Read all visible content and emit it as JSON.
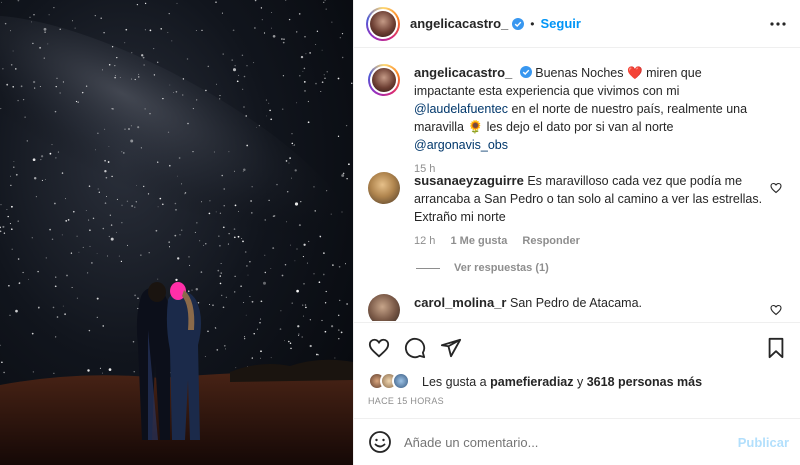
{
  "header": {
    "username": "angelicacastro_",
    "separator": "•",
    "follow_label": "Seguir",
    "more_icon": "more-horizontal-icon"
  },
  "caption": {
    "username": "angelicacastro_",
    "text_1": "Buenas Noches",
    "heart": "❤️",
    "text_2": "miren que impactante esta experiencia que vivimos con mi",
    "mention_1": "@laudelafuentec",
    "text_3": "en el norte de nuestro país, realmente una maravilla",
    "sunflower": "🌻",
    "text_4": "les dejo el dato por si van al norte",
    "mention_2": "@argonavis_obs",
    "time": "15 h"
  },
  "comments": [
    {
      "username": "susanaeyzaguirre",
      "text": "Es maravilloso cada vez que podía me arrancaba a San Pedro o tan solo al camino a ver las estrellas. Extraño mi norte",
      "time": "12 h",
      "likes": "1 Me gusta",
      "reply": "Responder",
      "view_replies": "Ver respuestas (1)"
    },
    {
      "username": "carol_molina_r",
      "text": "San Pedro de Atacama."
    }
  ],
  "likes": {
    "prefix": "Les gusta a",
    "user": "pamefieradiaz",
    "connector": "y",
    "others": "3618 personas más"
  },
  "time_ago": "HACE 15 HORAS",
  "composer": {
    "placeholder": "Añade un comentario...",
    "publish": "Publicar"
  },
  "colors": {
    "accent": "#0095f6",
    "publish_disabled": "#b2dffc",
    "mention": "#00376b",
    "muted": "#8e8e8e",
    "verified": "#3897f0"
  }
}
